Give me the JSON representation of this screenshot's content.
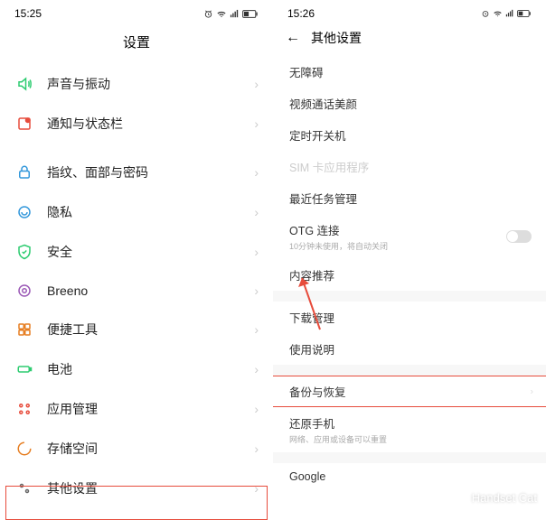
{
  "left": {
    "status": {
      "time": "15:25"
    },
    "title": "设置",
    "items": [
      {
        "label": "声音与振动"
      },
      {
        "label": "通知与状态栏"
      },
      {
        "label": "指纹、面部与密码"
      },
      {
        "label": "隐私"
      },
      {
        "label": "安全"
      },
      {
        "label": "Breeno"
      },
      {
        "label": "便捷工具"
      },
      {
        "label": "电池"
      },
      {
        "label": "应用管理"
      },
      {
        "label": "存储空间"
      },
      {
        "label": "其他设置"
      }
    ]
  },
  "right": {
    "status": {
      "time": "15:26"
    },
    "title": "其他设置",
    "items": [
      {
        "label": "无障碍"
      },
      {
        "label": "视频通话美颜"
      },
      {
        "label": "定时开关机"
      },
      {
        "label": "SIM 卡应用程序",
        "disabled": true
      },
      {
        "label": "最近任务管理"
      },
      {
        "label": "OTG 连接",
        "sub": "10分钟未使用，将自动关闭",
        "toggle": true
      },
      {
        "label": "内容推荐"
      },
      {
        "label": "下载管理"
      },
      {
        "label": "使用说明"
      },
      {
        "label": "备份与恢复",
        "highlight": true
      },
      {
        "label": "还原手机",
        "sub": "网络、应用或设备可以重置"
      },
      {
        "label": "Google"
      }
    ]
  },
  "watermark": "Handset Cat"
}
